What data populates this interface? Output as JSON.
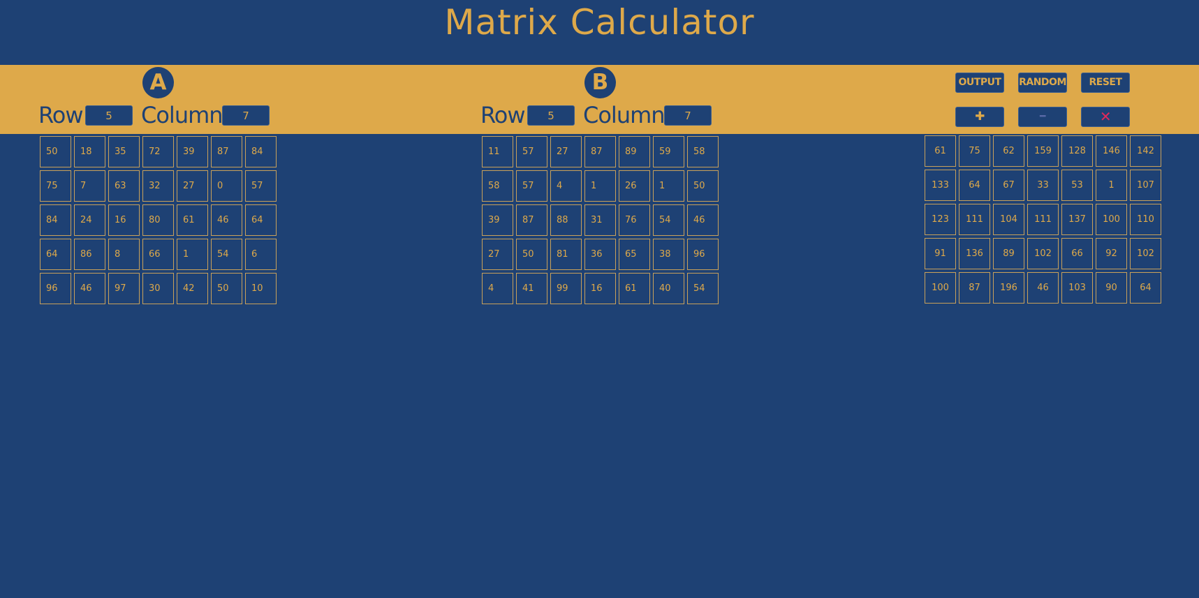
{
  "title": "Matrix Calculator",
  "colors": {
    "background": "#1e4174",
    "accent": "#dea94a",
    "multiply": "#e2285a"
  },
  "matrix_a": {
    "badge": "A",
    "row_label": "Row",
    "column_label": "Column",
    "rows": "5",
    "columns": "7",
    "values": [
      [
        "50",
        "18",
        "35",
        "72",
        "39",
        "87",
        "84"
      ],
      [
        "75",
        "7",
        "63",
        "32",
        "27",
        "0",
        "57"
      ],
      [
        "84",
        "24",
        "16",
        "80",
        "61",
        "46",
        "64"
      ],
      [
        "64",
        "86",
        "8",
        "66",
        "1",
        "54",
        "6"
      ],
      [
        "96",
        "46",
        "97",
        "30",
        "42",
        "50",
        "10"
      ]
    ]
  },
  "matrix_b": {
    "badge": "B",
    "row_label": "Row",
    "column_label": "Column",
    "rows": "5",
    "columns": "7",
    "values": [
      [
        "11",
        "57",
        "27",
        "87",
        "89",
        "59",
        "58"
      ],
      [
        "58",
        "57",
        "4",
        "1",
        "26",
        "1",
        "50"
      ],
      [
        "39",
        "87",
        "88",
        "31",
        "76",
        "54",
        "46"
      ],
      [
        "27",
        "50",
        "81",
        "36",
        "65",
        "38",
        "96"
      ],
      [
        "4",
        "41",
        "99",
        "16",
        "61",
        "40",
        "54"
      ]
    ]
  },
  "actions": {
    "output_label": "OUTPUT",
    "random_label": "RANDOM",
    "reset_label": "RESET",
    "add_label": "✚",
    "subtract_label": "━",
    "multiply_label": "✕"
  },
  "result": {
    "values": [
      [
        "61",
        "75",
        "62",
        "159",
        "128",
        "146",
        "142"
      ],
      [
        "133",
        "64",
        "67",
        "33",
        "53",
        "1",
        "107"
      ],
      [
        "123",
        "111",
        "104",
        "111",
        "137",
        "100",
        "110"
      ],
      [
        "91",
        "136",
        "89",
        "102",
        "66",
        "92",
        "102"
      ],
      [
        "100",
        "87",
        "196",
        "46",
        "103",
        "90",
        "64"
      ]
    ]
  }
}
